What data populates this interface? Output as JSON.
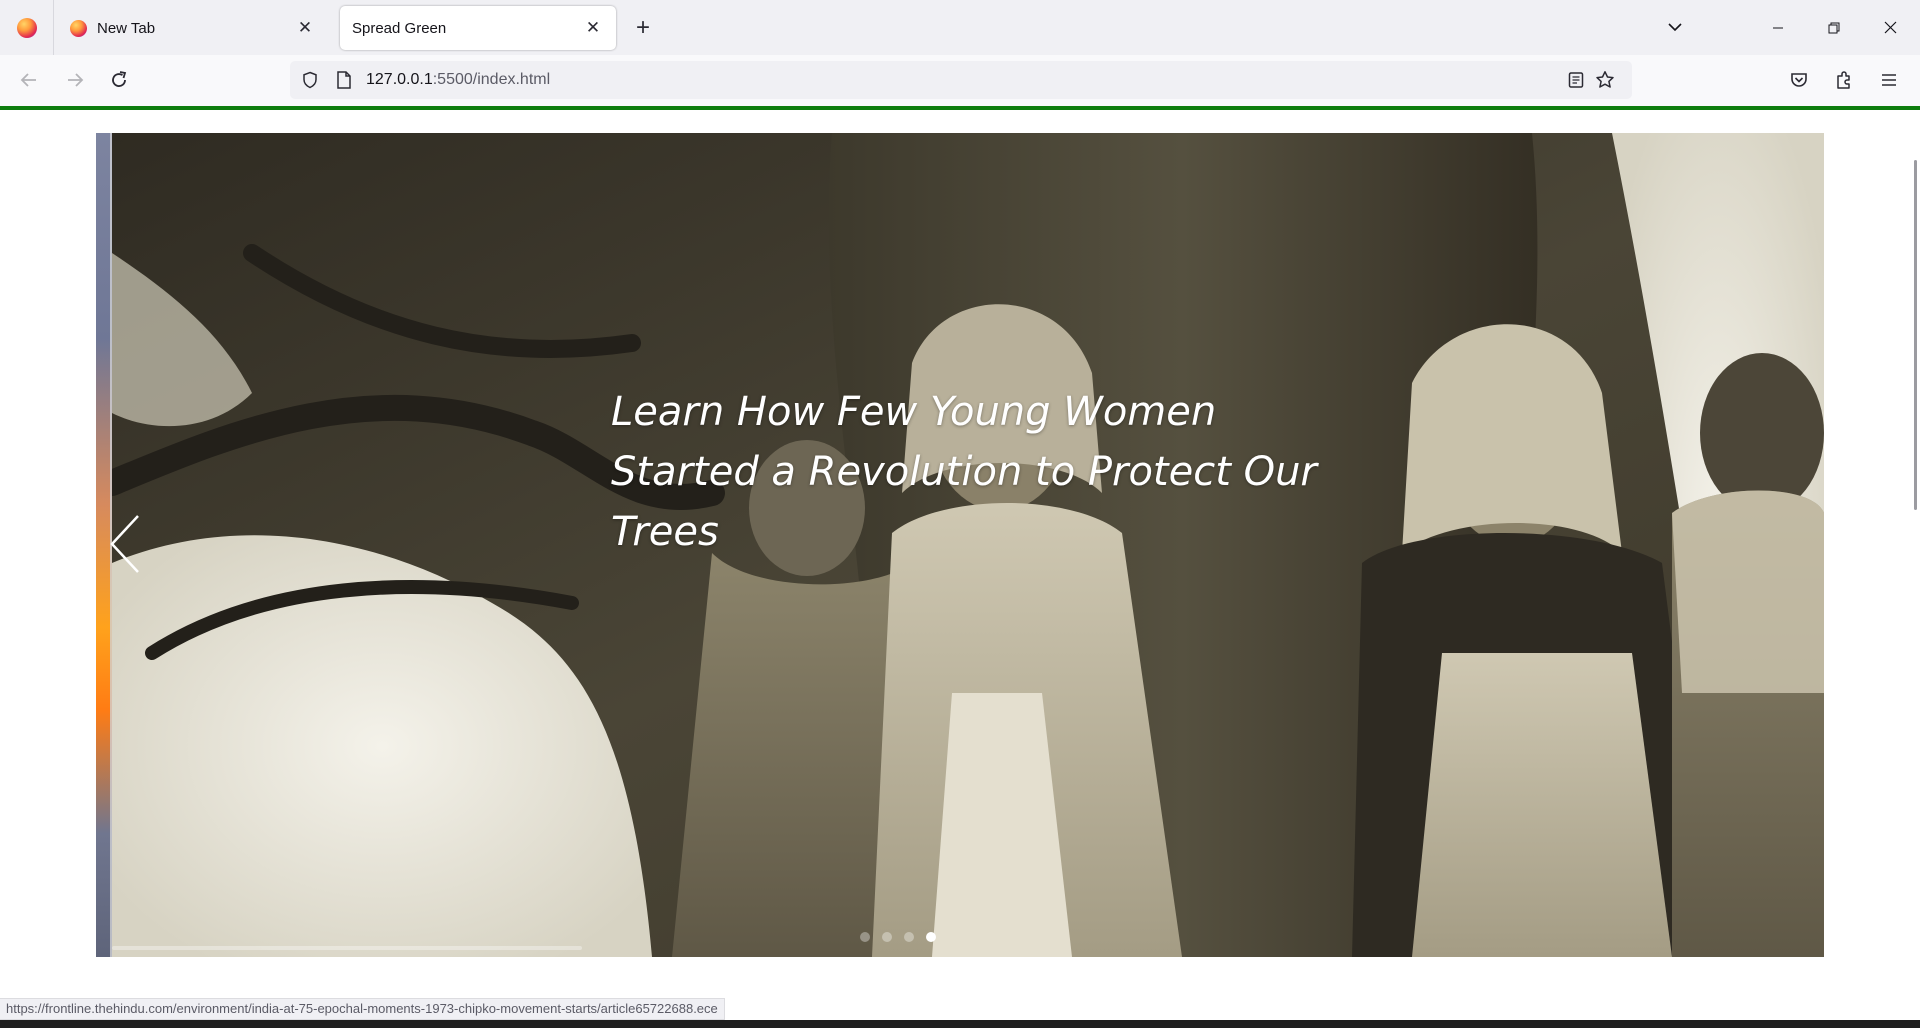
{
  "browser": {
    "tabs": [
      {
        "title": "New Tab",
        "active": false
      },
      {
        "title": "Spread Green",
        "active": true
      }
    ],
    "close_glyph": "✕",
    "new_tab_glyph": "+",
    "url": {
      "host": "127.0.0.1",
      "path": ":5500/index.html"
    },
    "window_controls": {
      "minimize": "—",
      "restore": "❐",
      "close": "✕"
    }
  },
  "page": {
    "accent_color": "#0d7d0d",
    "carousel": {
      "caption": "Learn How Few Young Women Started a Revolution to Protect Our Trees",
      "dot_count": 4,
      "active_dot": 3
    }
  },
  "status_bar": {
    "link": "https://frontline.thehindu.com/environment/india-at-75-epochal-moments-1973-chipko-movement-starts/article65722688.ece"
  },
  "icons": [
    "firefox-icon",
    "back-icon",
    "forward-icon",
    "reload-icon",
    "shield-icon",
    "page-icon",
    "reader-view-icon",
    "bookmark-star-icon",
    "pocket-icon",
    "extensions-icon",
    "hamburger-menu-icon",
    "chevron-down-icon",
    "chevron-left-icon"
  ]
}
